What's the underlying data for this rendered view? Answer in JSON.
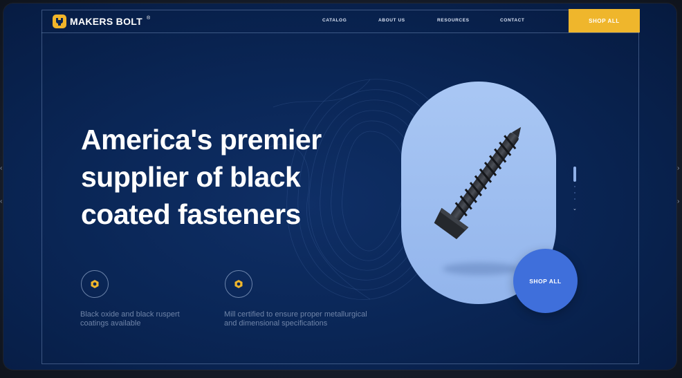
{
  "brand": {
    "name": "MAKERS BOLT",
    "registered": "®",
    "accent": "#efb62c"
  },
  "nav": {
    "links": [
      "CATALOG",
      "ABOUT US",
      "RESOURCES",
      "CONTACT"
    ],
    "cta": "SHOP ALL"
  },
  "hero": {
    "headline_lines": [
      "America's premier",
      "supplier of black",
      "coated fasteners"
    ],
    "cta": "SHOP ALL",
    "product_icon": "screw-image"
  },
  "features": [
    {
      "icon": "hex-nut-icon",
      "text_lines": [
        "Black oxide and black ruspert",
        "coatings available"
      ]
    },
    {
      "icon": "hex-nut-icon",
      "text_lines": [
        "Mill certified to ensure proper metallurgical",
        "and dimensional specifications"
      ]
    }
  ],
  "slider": {
    "active_index": 0,
    "count": 4,
    "next_icon": "chevron-down-icon"
  },
  "colors": {
    "background": "#0a2656",
    "pill": "#a9c7f4",
    "cta_circle": "#3f6fdb"
  }
}
